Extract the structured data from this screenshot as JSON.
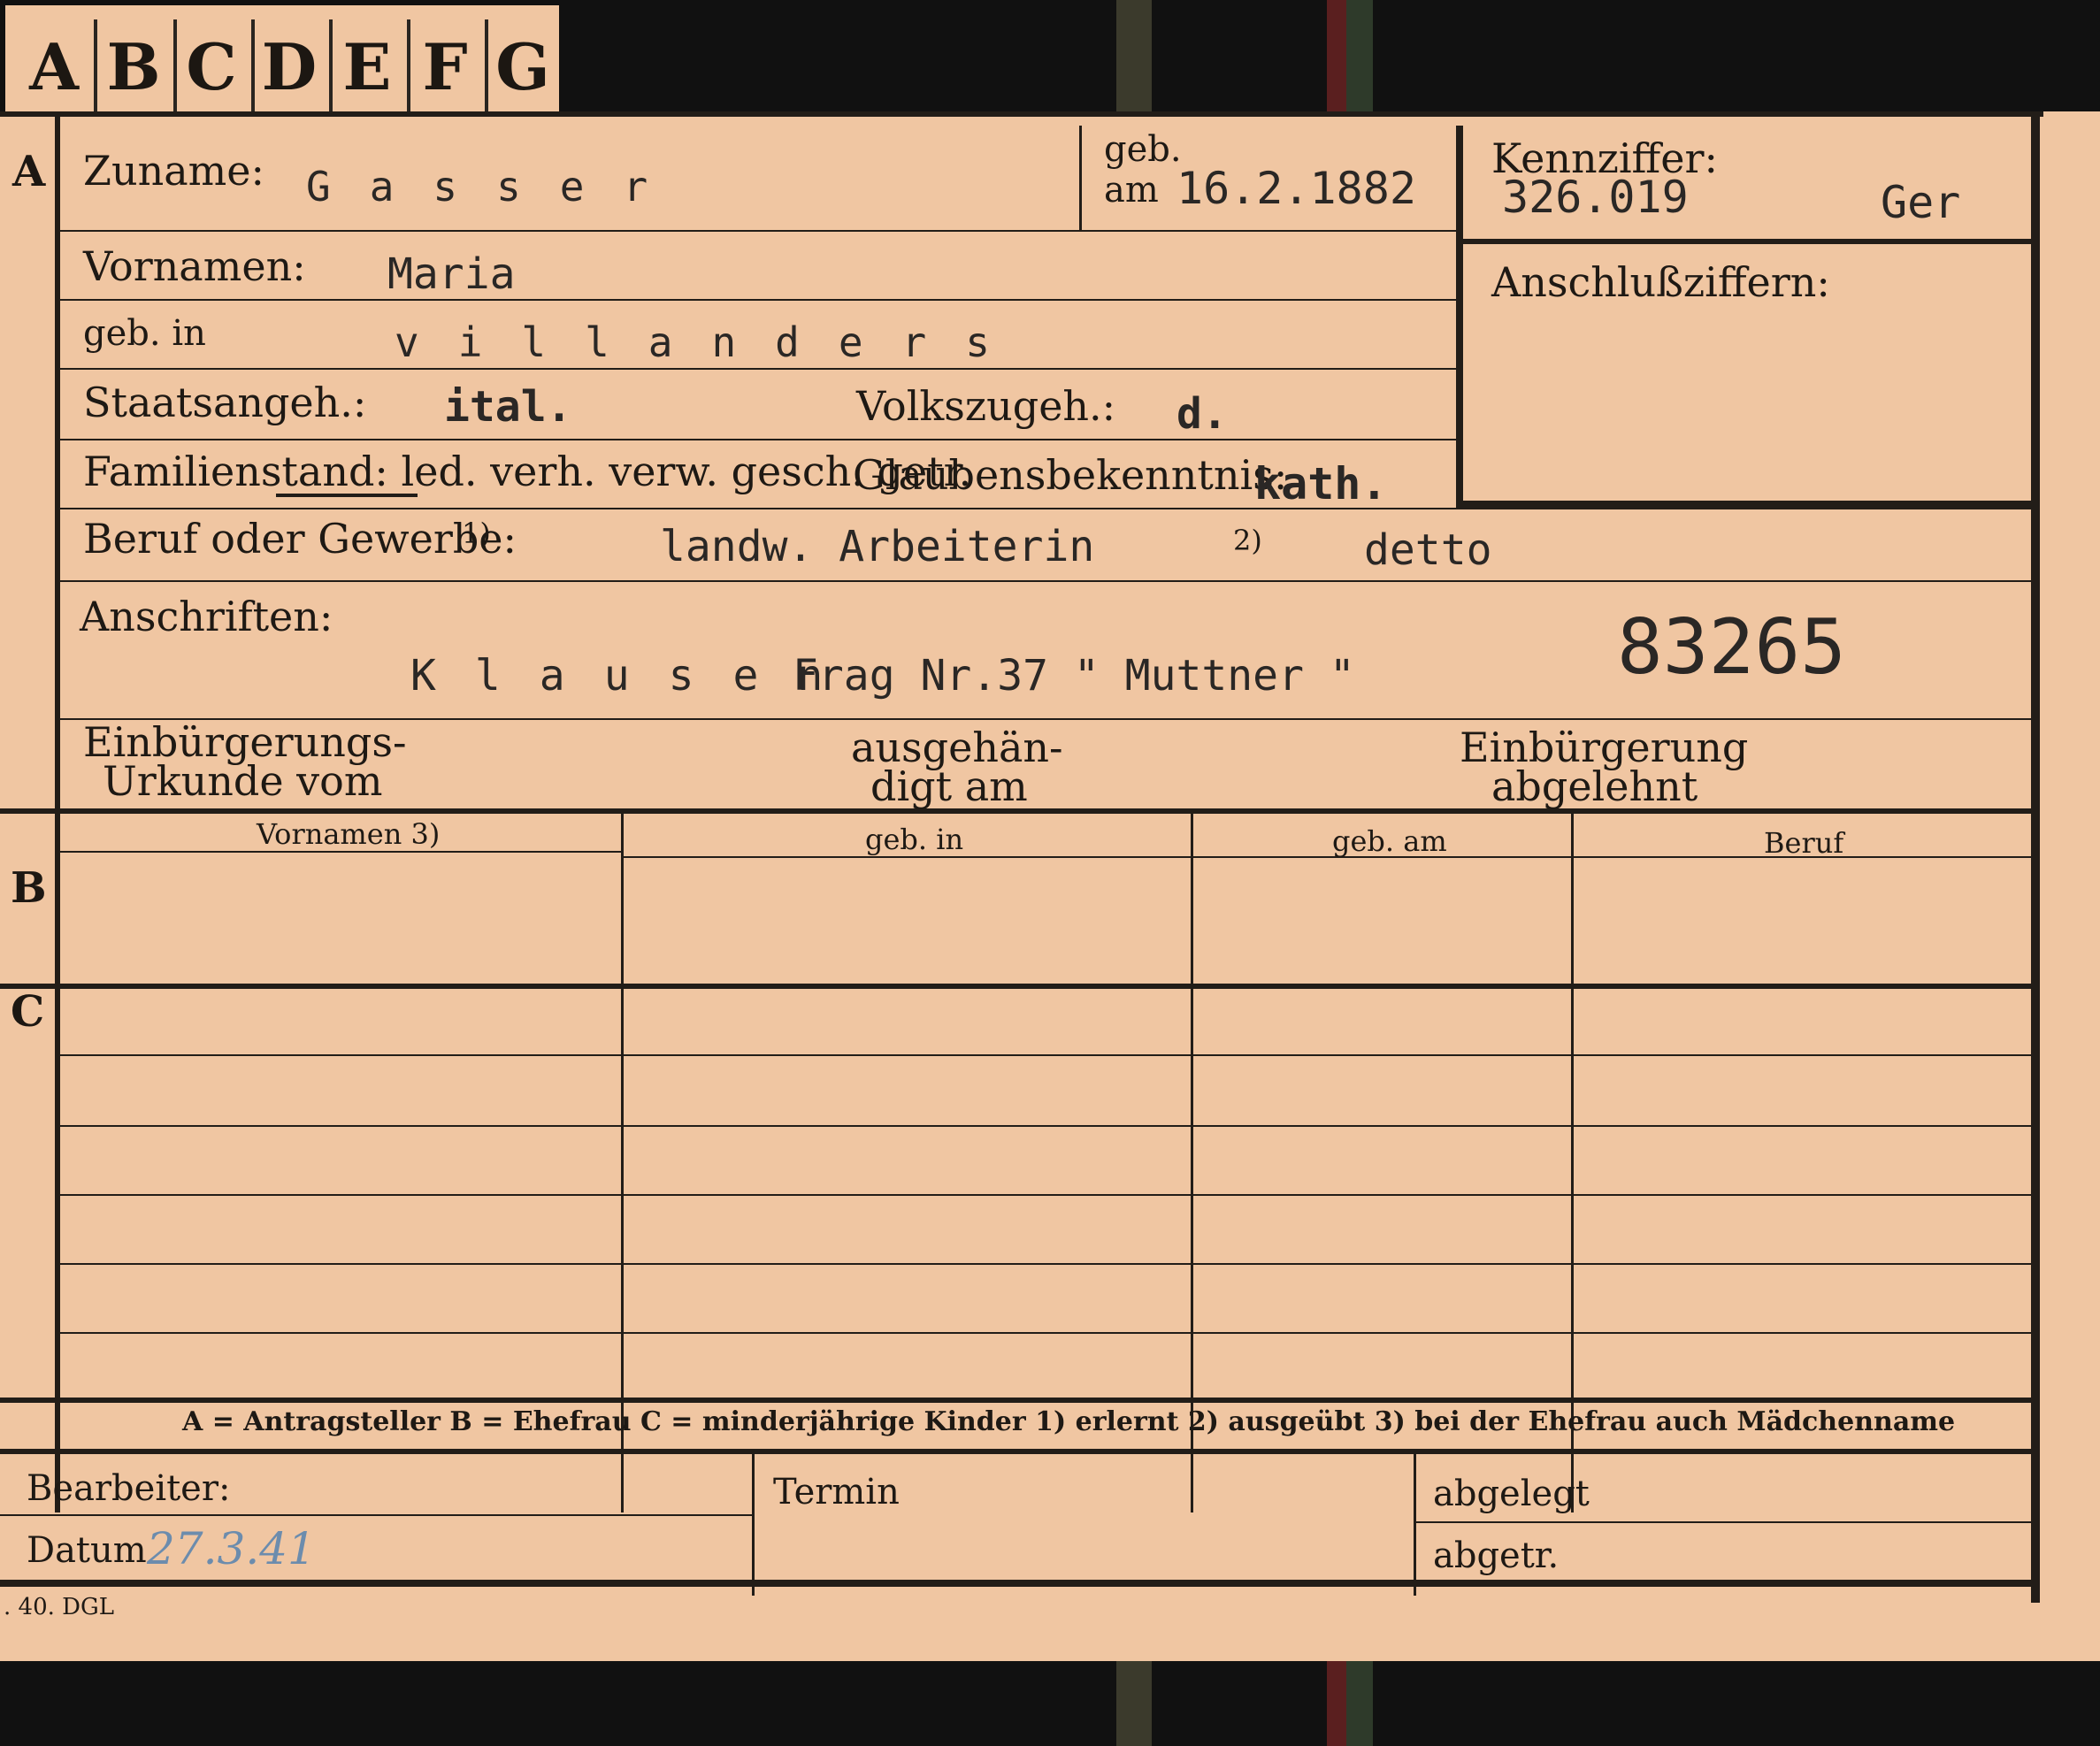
{
  "tabs": [
    "A",
    "B",
    "C",
    "D",
    "E",
    "F",
    "G"
  ],
  "sections": {
    "a": "A",
    "b": "B",
    "c": "C"
  },
  "labels": {
    "zuname": "Zuname:",
    "geb": "geb.",
    "am": "am",
    "kennziffer": "Kennziffer:",
    "vornamen": "Vornamen:",
    "anschlussziffern": "Anschlußziffern:",
    "geb_in": "geb. in",
    "staatsangeh": "Staatsangeh.:",
    "volkszugeh": "Volkszugeh.:",
    "familienstand": "Familienstand: led. verh. verw. gesch. getr.",
    "glaubensbekenntnis": "Glaubensbekenntnis:",
    "beruf": "Beruf oder Gewerbe:",
    "beruf_note1": "1)",
    "beruf_note2": "2)",
    "anschriften": "Anschriften:",
    "einbuergerung_urkunde_1": "Einbürgerungs-",
    "einbuergerung_urkunde_2": "Urkunde vom",
    "ausgehaendigt_1": "ausgehän-",
    "ausgehaendigt_2": "digt am",
    "einbuergerung_abgelehnt_1": "Einbürgerung",
    "einbuergerung_abgelehnt_2": "abgelehnt"
  },
  "values": {
    "zuname": "Gasser",
    "geburtsdatum": "16.2.1882",
    "kennziffer": "326.019",
    "kennziffer_suffix": "Ger",
    "vornamen": "Maria",
    "geburtsort": "villanders",
    "staatsangehoerigkeit": "ital.",
    "volkszugehoerigkeit": "d.",
    "glaubensbekenntnis": "kath.",
    "beruf_erlernt": "landw. Arbeiterin",
    "beruf_ausgeuebt": "detto",
    "anschrift": "Klausen",
    "anschrift_rest": "Frag Nr.37 \" Muttner \"",
    "stamp_number": "83265"
  },
  "table": {
    "columns": [
      "Vornamen 3)",
      "geb. in",
      "geb. am",
      "Beruf"
    ]
  },
  "footer": {
    "legend": "A = Antragsteller   B = Ehefrau   C = minderjährige Kinder   1) erlernt   2) ausgeübt   3) bei der Ehefrau auch Mädchenname",
    "bearbeiter": "Bearbeiter:",
    "termin": "Termin",
    "abgelegt": "abgelegt",
    "datum": "Datum",
    "abgetr": "abgetr.",
    "datum_value": "27.3.41",
    "print_code": ". 40. DGL"
  }
}
